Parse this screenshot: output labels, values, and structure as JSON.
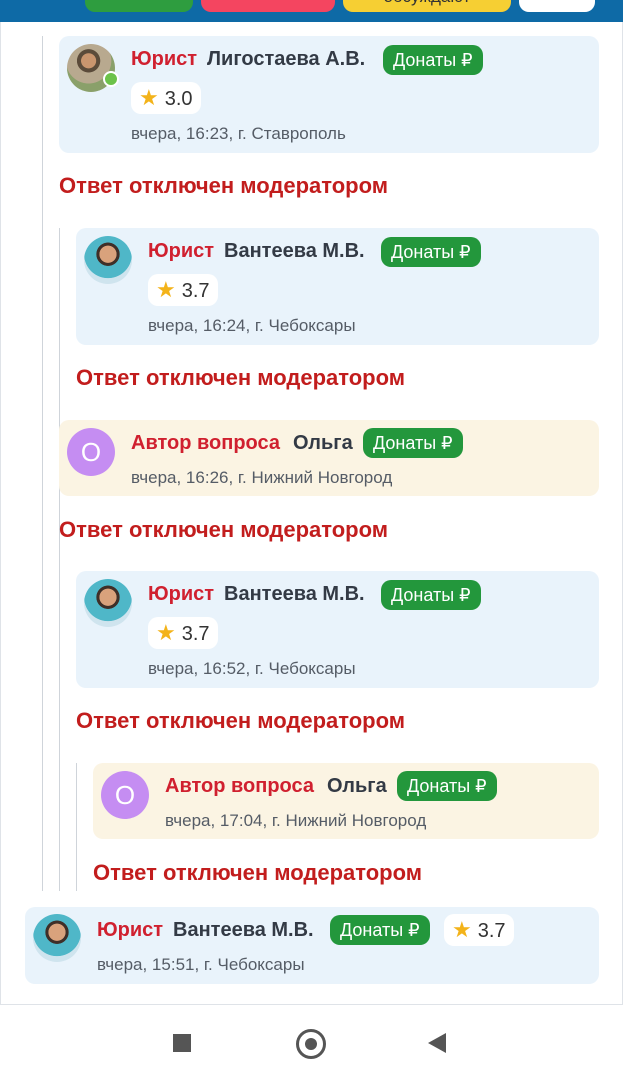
{
  "header": {
    "tab_partial_label": "обсуждают"
  },
  "colors": {
    "header_bg": "#0e6aa6",
    "role_red": "#d0202f",
    "donate_green": "#23973c",
    "moderated_red": "#c21d1d",
    "lawyer_card_bg": "#e9f3fb",
    "author_card_bg": "#fbf4e3"
  },
  "thread": [
    {
      "role": "Юрист",
      "name": "Лигостаева А.В.",
      "donate": "Донаты ₽",
      "rating": "3.0",
      "meta": "вчера, 16:23,  г. Ставрополь",
      "online": true,
      "moderated": "Ответ отключен модератором"
    },
    {
      "role": "Юрист",
      "name": "Вантеева М.В.",
      "donate": "Донаты ₽",
      "rating": "3.7",
      "meta": "вчера, 16:24,  г. Чебоксары",
      "moderated": "Ответ отключен модератором"
    },
    {
      "role": "Автор вопроса",
      "name": "Ольга",
      "avatar_letter": "О",
      "donate": "Донаты ₽",
      "meta": "вчера, 16:26,  г. Нижний Новгород",
      "moderated": "Ответ отключен модератором"
    },
    {
      "role": "Юрист",
      "name": "Вантеева М.В.",
      "donate": "Донаты ₽",
      "rating": "3.7",
      "meta": "вчера, 16:52,  г. Чебоксары",
      "moderated": "Ответ отключен модератором"
    },
    {
      "role": "Автор вопроса",
      "name": "Ольга",
      "avatar_letter": "О",
      "donate": "Донаты ₽",
      "meta": "вчера, 17:04,  г. Нижний Новгород",
      "moderated": "Ответ отключен модератором"
    },
    {
      "role": "Юрист",
      "name": "Вантеева М.В.",
      "donate": "Донаты ₽",
      "rating": "3.7",
      "meta": "вчера, 15:51,  г. Чебоксары"
    }
  ],
  "icons": {
    "star": "star-icon",
    "nav_recents": "recents-square-icon",
    "nav_home": "home-circle-icon",
    "nav_back": "back-triangle-icon"
  }
}
